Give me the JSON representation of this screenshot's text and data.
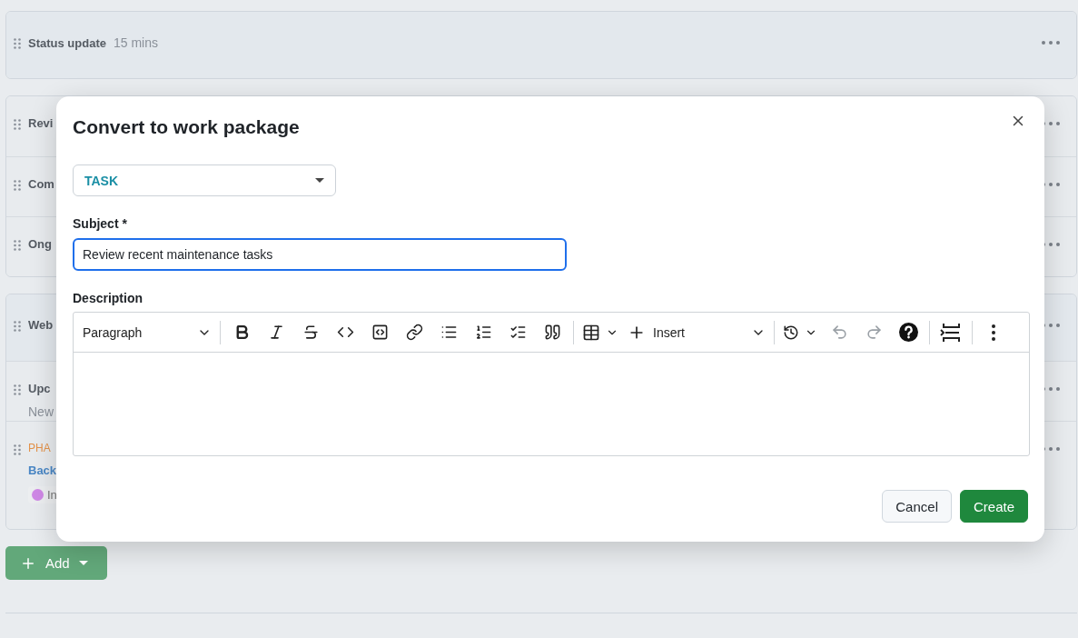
{
  "agenda": {
    "sections": [
      {
        "items": [
          {
            "kind": "header",
            "title": "Status update",
            "duration": "15 mins"
          }
        ]
      },
      {
        "items": [
          {
            "kind": "item",
            "title": "Revi"
          },
          {
            "kind": "item",
            "title": "Com"
          },
          {
            "kind": "item",
            "title": "Ong"
          }
        ]
      },
      {
        "items": [
          {
            "kind": "header",
            "title": "Web"
          },
          {
            "kind": "item",
            "title": "Upc",
            "note": "New"
          },
          {
            "kind": "workpackage",
            "title": "PHA",
            "link": "Back",
            "status": "In",
            "color": "#cf88e6"
          }
        ]
      }
    ]
  },
  "add_button": {
    "label": "Add"
  },
  "dialog": {
    "title": "Convert to work package",
    "type": {
      "value": "TASK"
    },
    "subject": {
      "label": "Subject *",
      "value": "Review recent maintenance tasks",
      "focused": true
    },
    "description": {
      "label": "Description",
      "toolbar": [
        {
          "kind": "paragraph",
          "label": "Paragraph"
        },
        {
          "kind": "separator"
        },
        {
          "kind": "bold"
        },
        {
          "kind": "italic"
        },
        {
          "kind": "strike"
        },
        {
          "kind": "code"
        },
        {
          "kind": "codeblock"
        },
        {
          "kind": "link"
        },
        {
          "kind": "bullets"
        },
        {
          "kind": "numbers"
        },
        {
          "kind": "todo"
        },
        {
          "kind": "quote"
        },
        {
          "kind": "separator"
        },
        {
          "kind": "table"
        },
        {
          "kind": "insert",
          "label": "Insert"
        },
        {
          "kind": "separator"
        },
        {
          "kind": "history"
        },
        {
          "kind": "undo",
          "disabled": true
        },
        {
          "kind": "redo",
          "disabled": true
        },
        {
          "kind": "help"
        },
        {
          "kind": "separator"
        },
        {
          "kind": "pagebreak"
        },
        {
          "kind": "separator"
        },
        {
          "kind": "more"
        }
      ]
    },
    "buttons": [
      {
        "kind": "secondary",
        "label": "Cancel"
      },
      {
        "kind": "primary",
        "label": "Create"
      }
    ]
  }
}
